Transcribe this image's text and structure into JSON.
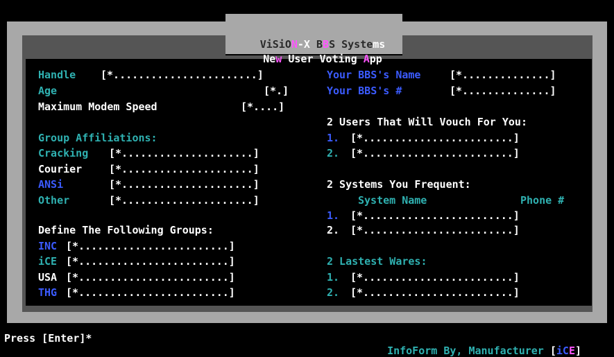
{
  "header": {
    "line1": {
      "a": "ViSiO",
      "b": "N",
      "c": "-X",
      "d": " B",
      "e": "B",
      "f": "S Syste",
      "g": "ms"
    },
    "line2": {
      "a": "Ne",
      "b": "w ",
      "c": "User",
      "d": " Voting ",
      "e": "A",
      "f": "pp"
    }
  },
  "left": {
    "handle": {
      "label": "Handle",
      "field": "[*.......................]"
    },
    "age": {
      "label": "Age",
      "field": "[*.]"
    },
    "modem": {
      "label": "Maximum Modem Speed",
      "field": "[*....]"
    },
    "group_title": "Group Affiliations:",
    "cracking": {
      "label": "Cracking",
      "field": "[*.....................]"
    },
    "courier": {
      "label": "Courier",
      "field": "[*.....................]"
    },
    "ansi": {
      "label": "ANSi",
      "field": "[*.....................]"
    },
    "other": {
      "label": "Other",
      "field": "[*.....................]"
    },
    "define_title": "Define The Following Groups:",
    "inc": {
      "label": "INC",
      "field": "[*........................]"
    },
    "ice": {
      "label": "iCE",
      "field": "[*........................]"
    },
    "usa": {
      "label": "USA",
      "field": "[*........................]"
    },
    "thg": {
      "label": "THG",
      "field": "[*........................]"
    }
  },
  "right": {
    "bbs_name": {
      "label": "Your BBS's Name",
      "field": "[*..............]"
    },
    "bbs_num": {
      "label": "Your BBS's #",
      "field": "[*..............]"
    },
    "vouch_title": "2 Users That Will Vouch For You:",
    "vouch1": {
      "num": "1.",
      "field": "[*........................]"
    },
    "vouch2": {
      "num": "2.",
      "field": "[*........................]"
    },
    "systems_title": "2 Systems You Frequent:",
    "col_system": "System Name",
    "col_phone": "Phone #",
    "sys1": {
      "num": "1.",
      "field": "[*........................]"
    },
    "sys2": {
      "num": "2.",
      "field": "[*........................]"
    },
    "wares_title": "2 Lastest Wares:",
    "ware1": {
      "num": "1.",
      "field": "[*........................]"
    },
    "ware2": {
      "num": "2.",
      "field": "[*........................]"
    }
  },
  "status": {
    "left": "Press [Enter]*",
    "right_text": "InfoForm By, Manufacturer ",
    "right_bracket_open": "[",
    "right_tag_a": "iC",
    "right_tag_b": "E",
    "right_bracket_close": "]"
  }
}
